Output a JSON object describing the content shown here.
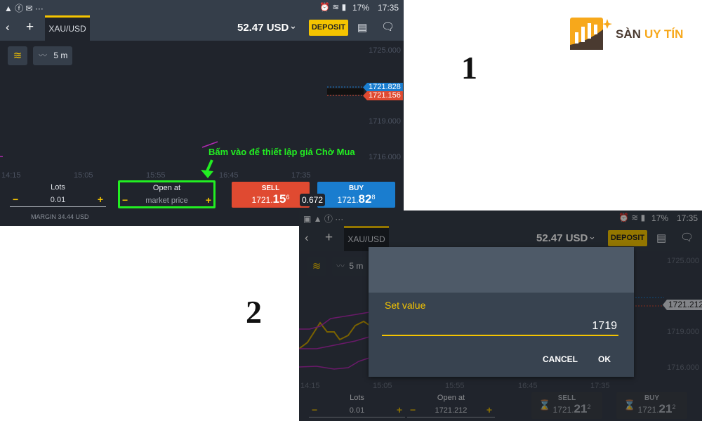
{
  "logo": {
    "text_a": "SÀN",
    "text_b": "UY TÍN"
  },
  "step_labels": [
    "1",
    "2"
  ],
  "annotation": "Bấm vào để thiết lập giá Chờ Mua",
  "colors": {
    "accent": "#f5c400",
    "sell": "#e04a31",
    "buy": "#1a7dcf",
    "annotation": "#22ee22"
  },
  "screen1": {
    "status": {
      "battery": "17%",
      "time": "17:35"
    },
    "header": {
      "tab": "XAU/USD",
      "balance": "52.47 USD",
      "deposit": "DEPOSIT"
    },
    "toolbar": {
      "timeframe": "5 m"
    },
    "y_ticks": [
      "1725.000",
      "1719.000",
      "1716.000"
    ],
    "price_tags": {
      "ask": "1721.828",
      "bid": "1721.156"
    },
    "x_ticks": [
      "14:15",
      "15:05",
      "15:55",
      "16:45",
      "17:35"
    ],
    "lots": {
      "label": "Lots",
      "value": "0.01"
    },
    "open_at": {
      "label": "Open at",
      "value": "market price"
    },
    "sell": {
      "label": "SELL",
      "price_main": "1721.",
      "price_big": "15",
      "price_sup": "6"
    },
    "buy": {
      "label": "BUY",
      "price_main": "1721.",
      "price_big": "82",
      "price_sup": "8"
    },
    "spread": "0.672",
    "margin": "MARGIN 34.44 USD"
  },
  "screen2": {
    "status": {
      "battery": "17%",
      "time": "17:35"
    },
    "header": {
      "tab": "XAU/USD",
      "balance": "52.47 USD",
      "deposit": "DEPOSIT"
    },
    "toolbar": {
      "timeframe": "5 m"
    },
    "y_ticks": [
      "1725.000",
      "1719.000",
      "1716.000"
    ],
    "price_tag": "1721.212",
    "x_ticks": [
      "14:15",
      "15:05",
      "15:55",
      "16:45",
      "17:35"
    ],
    "lots": {
      "label": "Lots",
      "value": "0.01"
    },
    "open_at": {
      "label": "Open at",
      "value": "1721.212"
    },
    "sell": {
      "label": "SELL",
      "price_main": "1721.",
      "price_big": "21",
      "price_sup": "2"
    },
    "buy": {
      "label": "BUY",
      "price_main": "1721.",
      "price_big": "21",
      "price_sup": "2"
    },
    "dialog": {
      "title": "Set value",
      "value": "1719",
      "cancel": "CANCEL",
      "ok": "OK"
    }
  }
}
